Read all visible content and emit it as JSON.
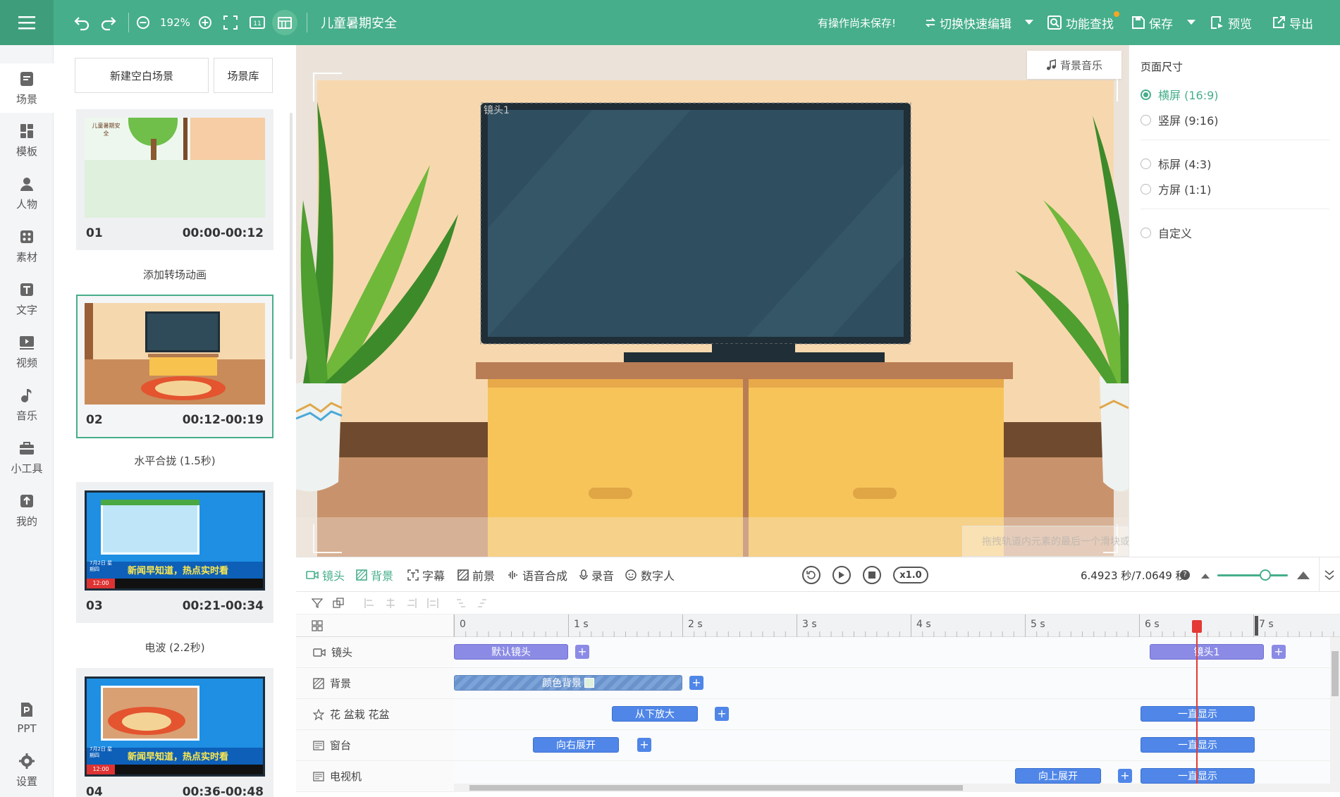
{
  "colors": {
    "brand": "#46ae8a",
    "clip_purple": "#8b8be6",
    "clip_blue": "#4f86e8",
    "playhead": "#e53935"
  },
  "topbar": {
    "menu_icon": "hamburger-icon",
    "zoom": "192%",
    "title": "儿童暑期安全",
    "unsaved": "有操作尚未保存!",
    "switch_edit": "切换快速编辑",
    "search": "功能查找",
    "save": "保存",
    "preview": "预览",
    "export": "导出"
  },
  "nav": {
    "items": [
      {
        "label": "场景",
        "icon": "scene-icon"
      },
      {
        "label": "模板",
        "icon": "template-icon"
      },
      {
        "label": "人物",
        "icon": "person-icon"
      },
      {
        "label": "素材",
        "icon": "material-icon"
      },
      {
        "label": "文字",
        "icon": "text-icon"
      },
      {
        "label": "视频",
        "icon": "video-icon"
      },
      {
        "label": "音乐",
        "icon": "music-icon"
      },
      {
        "label": "小工具",
        "icon": "toolbox-icon"
      },
      {
        "label": "我的",
        "icon": "upload-icon"
      },
      {
        "label": "PPT",
        "icon": "ppt-icon"
      },
      {
        "label": "设置",
        "icon": "gear-icon"
      }
    ]
  },
  "scenes": {
    "new_blank": "新建空白场景",
    "library": "场景库",
    "cards": [
      {
        "no": "01",
        "time": "00:00-00:12"
      },
      {
        "no": "02",
        "time": "00:12-00:19"
      },
      {
        "no": "03",
        "time": "00:21-00:34"
      },
      {
        "no": "04",
        "time": "00:36-00:48"
      }
    ],
    "transitions": [
      "添加转场动画",
      "水平合拢 (1.5秒)",
      "电波 (2.2秒)"
    ],
    "thumb1_text": "儿童暑期安全",
    "news_banner": "新闻早知道，热点实时看",
    "news_date": "7月2日 星期四",
    "news_time": "12:00"
  },
  "canvas": {
    "bg_music": "背景音乐",
    "camera_label": "镜头1",
    "hint": "拖拽轨道内元素的最后一个滑块或刻度尺末端滑块可增加或减少总时间"
  },
  "page_size": {
    "title": "页面尺寸",
    "options": [
      {
        "label": "横屏 (16:9)",
        "selected": true
      },
      {
        "label": "竖屏 (9:16)",
        "selected": false
      },
      {
        "label": "标屏 (4:3)",
        "selected": false
      },
      {
        "label": "方屏 (1:1)",
        "selected": false
      },
      {
        "label": "自定义",
        "selected": false
      }
    ]
  },
  "timeline": {
    "tabs": [
      "镜头",
      "背景",
      "字幕",
      "前景",
      "语音合成",
      "录音",
      "数字人"
    ],
    "speed": "x1.0",
    "time": "6.4923 秒/7.0649 秒",
    "ruler": [
      "0",
      "1 s",
      "2 s",
      "3 s",
      "4 s",
      "5 s",
      "6 s",
      "7 s"
    ],
    "tracks": [
      {
        "label": "镜头",
        "clips": [
          {
            "text": "默认镜头"
          },
          {
            "text": "镜头1"
          }
        ]
      },
      {
        "label": "背景",
        "clips": [
          {
            "text": "颜色背景"
          }
        ]
      },
      {
        "label": "花 盆栽 花盆",
        "clips": [
          {
            "text": "从下放大"
          },
          {
            "text": "一直显示"
          }
        ]
      },
      {
        "label": "窗台",
        "clips": [
          {
            "text": "向右展开"
          },
          {
            "text": "一直显示"
          }
        ]
      },
      {
        "label": "电视机",
        "clips": [
          {
            "text": "向上展开"
          },
          {
            "text": "一直显示"
          }
        ]
      }
    ]
  }
}
